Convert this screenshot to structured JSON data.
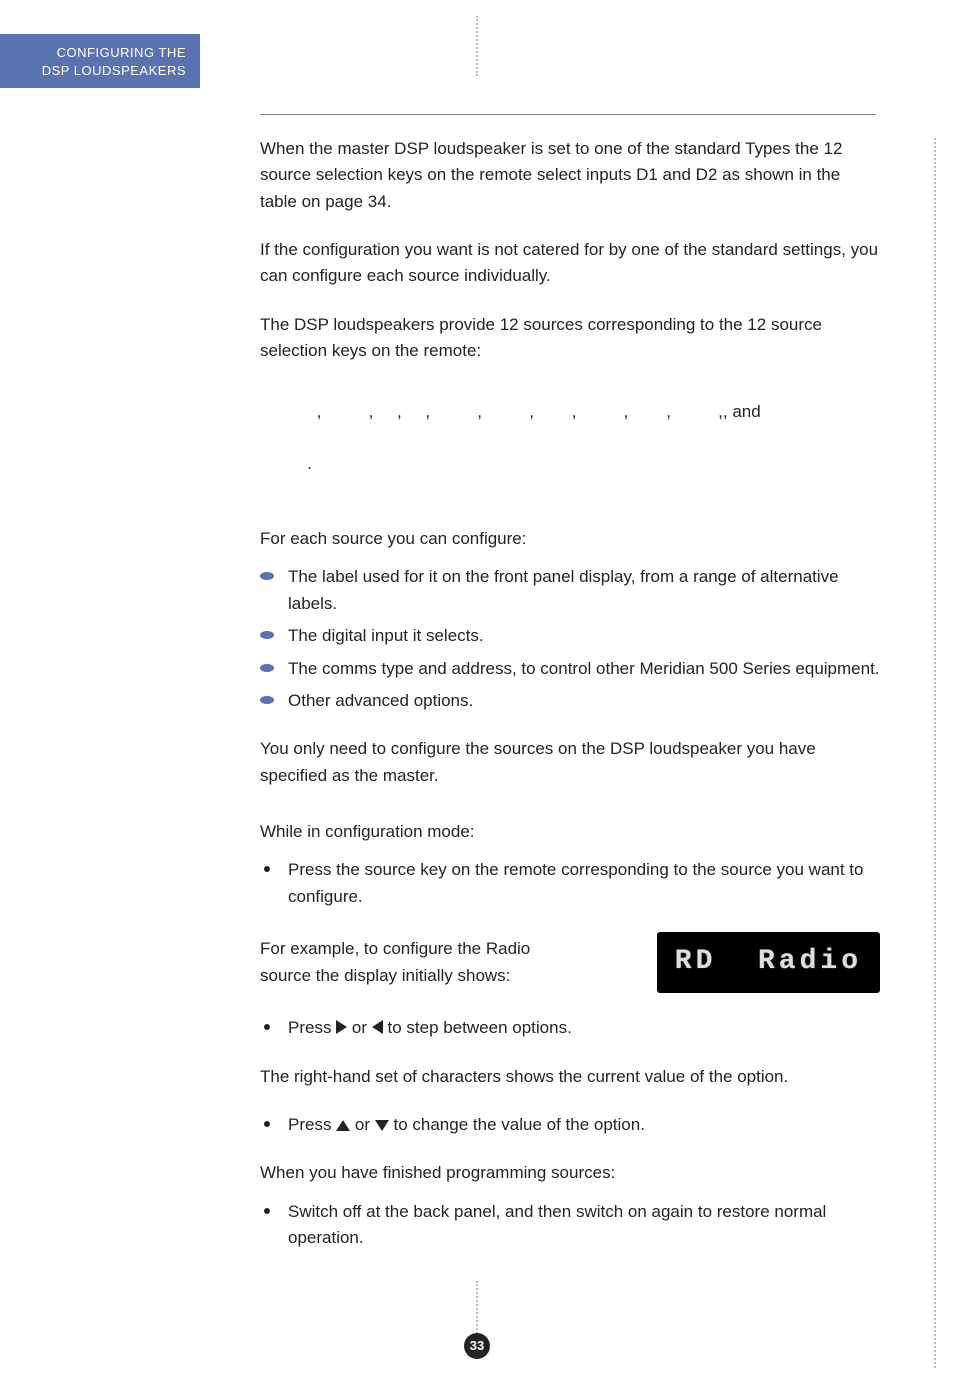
{
  "sidebar": {
    "line1": "CONFIGURING THE",
    "line2": "DSP LOUDSPEAKERS"
  },
  "paragraphs": {
    "p1": "When the master DSP loudspeaker is set to one of the standard Types the 12 source selection keys on the remote select inputs D1 and D2 as shown in the table on page 34.",
    "p2": "If the configuration you want is not catered for by one of the standard settings, you can configure each source individually.",
    "p3": "The DSP loudspeakers provide 12 sources corresponding to the 12 source selection keys on the remote:",
    "remotes_tail": ", and",
    "p4": "For each source you can configure:",
    "p5": "You only need to configure the sources on the DSP loudspeaker you have specified as the master.",
    "p6": "While in configuration mode:",
    "p7a": "For example, to configure the Radio",
    "p7b": "source the display initially shows:",
    "p8": "The right-hand set of characters shows the current value of the option.",
    "p9": "When you have finished programming sources:"
  },
  "config_bullets": [
    "The label used for it on the front panel display, from a range of alternative labels.",
    "The digital input it selects.",
    "The comms type and address, to control other Meridian 500 Series equipment.",
    "Other advanced options."
  ],
  "steps": {
    "s1": "Press the source key on the remote corresponding to the source you want to configure.",
    "s2a": "Press ",
    "s2b": " or ",
    "s2c": " to step between options.",
    "s3a": "Press ",
    "s3b": " or ",
    "s3c": " to change the value of the option.",
    "s4": "Switch off at the back panel, and then switch on again to restore normal operation."
  },
  "lcd": "RD  Radio",
  "commas_line": "      ,          ,     ,     ,          ,          ,        ,          ,        ,          ,",
  "dot_line": "    .",
  "page_number": "33"
}
